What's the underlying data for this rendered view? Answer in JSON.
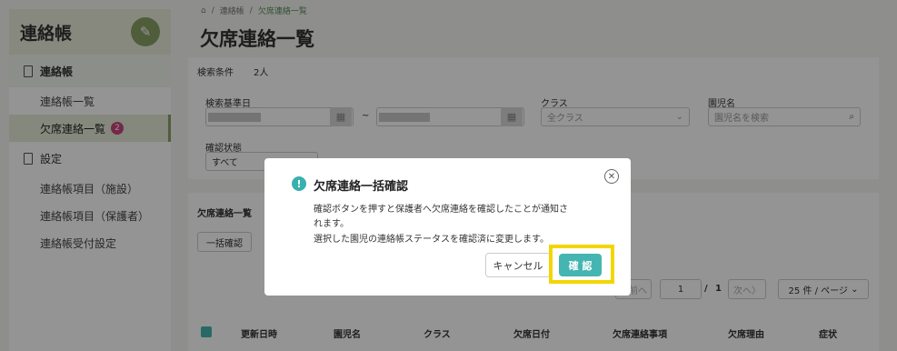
{
  "sidebar": {
    "app_title": "連絡帳",
    "sections": [
      {
        "label": "連絡帳"
      },
      {
        "label": "設定"
      }
    ],
    "items": [
      {
        "label": "連絡帳一覧"
      },
      {
        "label": "欠席連絡一覧",
        "badge": "2"
      },
      {
        "label": "連絡帳項目（施設）"
      },
      {
        "label": "連絡帳項目（保護者）"
      },
      {
        "label": "連絡帳受付設定"
      }
    ]
  },
  "breadcrumb": {
    "parent": "連絡帳",
    "current": "欠席連絡一覧"
  },
  "page_title": "欠席連絡一覧",
  "search": {
    "conditions_label": "検索条件",
    "count": "2人",
    "date_label": "検索基準日",
    "range_sep": "~",
    "class_label": "クラス",
    "class_value": "全クラス",
    "child_label": "園児名",
    "child_placeholder": "園児名を検索",
    "status_label": "確認状態",
    "status_value": "すべて"
  },
  "list": {
    "title": "欠席連絡一覧",
    "bulk_button": "一括確認",
    "pagination": {
      "prev": "前へ",
      "page": "1",
      "sep": "/",
      "total": "1",
      "next": "次へ",
      "per_page": "25 件 / ページ"
    },
    "columns": [
      "更新日時",
      "園児名",
      "クラス",
      "欠席日付",
      "欠席連絡事項",
      "欠席理由",
      "症状"
    ]
  },
  "modal": {
    "title": "欠席連絡一括確認",
    "line1": "確認ボタンを押すと保護者へ欠席連絡を確認したことが通知さ",
    "line2": "れます。",
    "line3": "選択した園児の連絡帳ステータスを確認済に変更します。",
    "cancel": "キャンセル",
    "confirm": "確 認"
  },
  "colors": {
    "accent": "#8aa167",
    "teal": "#45b5b2",
    "highlight": "#f2d600",
    "badge": "#c8457a"
  }
}
